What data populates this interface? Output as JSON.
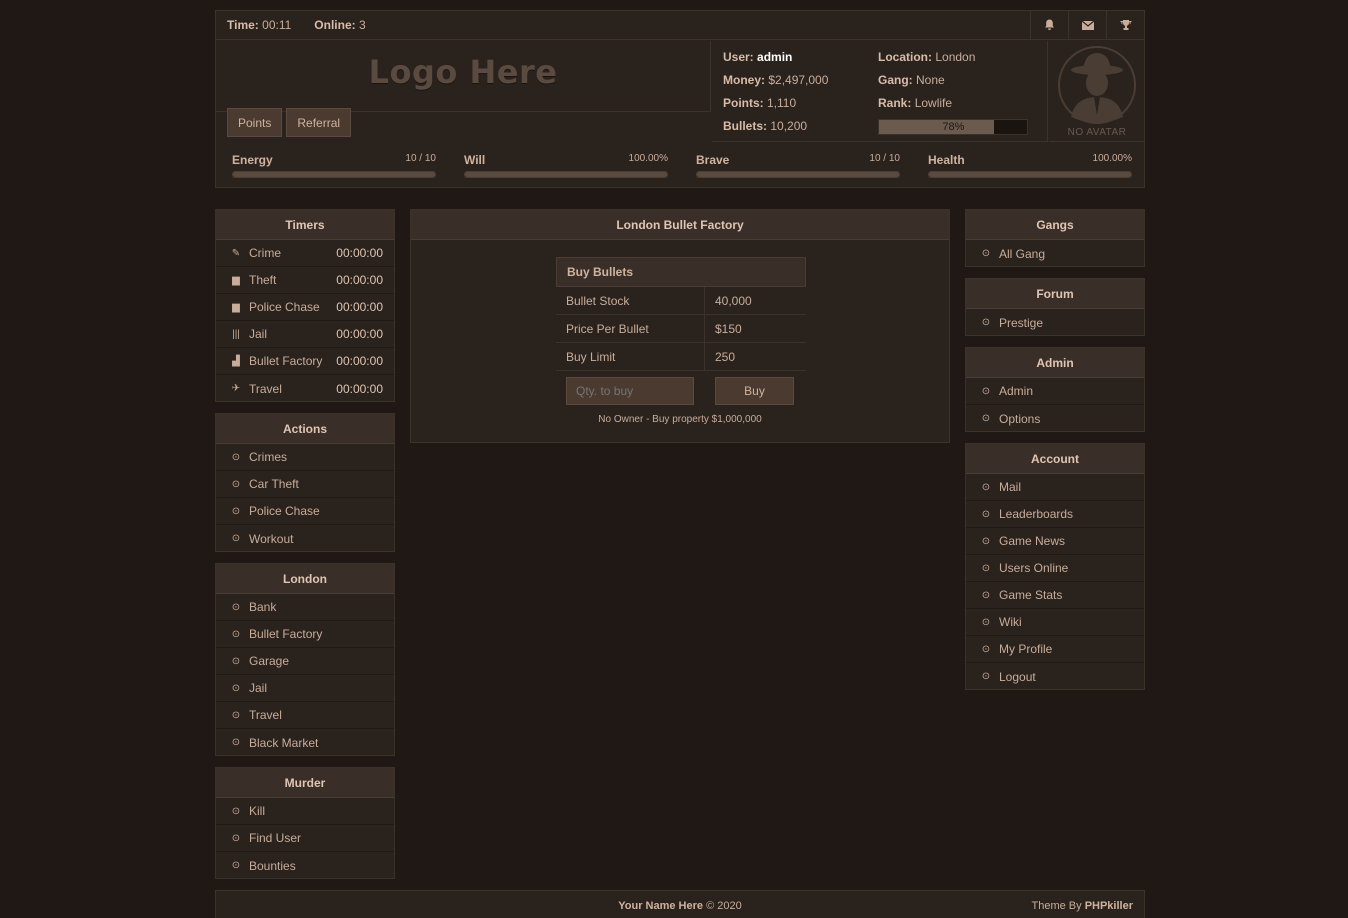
{
  "topbar": {
    "time_label": "Time:",
    "time_value": "00:11",
    "online_label": "Online:",
    "online_value": "3"
  },
  "logo": "Logo Here",
  "header_buttons": [
    "Points",
    "Referral"
  ],
  "user": {
    "user_label": "User:",
    "user_value": "admin",
    "money_label": "Money:",
    "money_value": "$2,497,000",
    "points_label": "Points:",
    "points_value": "1,110",
    "bullets_label": "Bullets:",
    "bullets_value": "10,200",
    "location_label": "Location:",
    "location_value": "London",
    "gang_label": "Gang:",
    "gang_value": "None",
    "rank_label": "Rank:",
    "rank_value": "Lowlife",
    "rank_progress": "78%",
    "no_avatar": "NO AVATAR"
  },
  "stats": [
    {
      "label": "Energy",
      "value": "10 / 10"
    },
    {
      "label": "Will",
      "value": "100.00%"
    },
    {
      "label": "Brave",
      "value": "10 / 10"
    },
    {
      "label": "Health",
      "value": "100.00%"
    }
  ],
  "timers": {
    "title": "Timers",
    "items": [
      {
        "label": "Crime",
        "time": "00:00:00",
        "icon": "crime-icon"
      },
      {
        "label": "Theft",
        "time": "00:00:00",
        "icon": "car-icon"
      },
      {
        "label": "Police Chase",
        "time": "00:00:00",
        "icon": "police-car-icon"
      },
      {
        "label": "Jail",
        "time": "00:00:00",
        "icon": "jail-bars-icon"
      },
      {
        "label": "Bullet Factory",
        "time": "00:00:00",
        "icon": "factory-icon"
      },
      {
        "label": "Travel",
        "time": "00:00:00",
        "icon": "plane-icon"
      }
    ]
  },
  "actions": {
    "title": "Actions",
    "items": [
      "Crimes",
      "Car Theft",
      "Police Chase",
      "Workout"
    ]
  },
  "london": {
    "title": "London",
    "items": [
      "Bank",
      "Bullet Factory",
      "Garage",
      "Jail",
      "Travel",
      "Black Market"
    ]
  },
  "murder": {
    "title": "Murder",
    "items": [
      "Kill",
      "Find User",
      "Bounties"
    ]
  },
  "gangs": {
    "title": "Gangs",
    "items": [
      "All Gang"
    ]
  },
  "forum": {
    "title": "Forum",
    "items": [
      "Prestige"
    ]
  },
  "admin": {
    "title": "Admin",
    "items": [
      "Admin",
      "Options"
    ]
  },
  "account": {
    "title": "Account",
    "items": [
      "Mail",
      "Leaderboards",
      "Game News",
      "Users Online",
      "Game Stats",
      "Wiki",
      "My Profile",
      "Logout"
    ]
  },
  "factory": {
    "title": "London Bullet Factory",
    "box_title": "Buy Bullets",
    "rows": [
      {
        "label": "Bullet Stock",
        "value": "40,000"
      },
      {
        "label": "Price Per Bullet",
        "value": "$150"
      },
      {
        "label": "Buy Limit",
        "value": "250"
      }
    ],
    "qty_placeholder": "Qty. to buy",
    "buy_label": "Buy",
    "owner_text": "No Owner - Buy property $1,000,000"
  },
  "footer": {
    "name": "Your Name Here",
    "year": "© 2020",
    "theme_label": "Theme By",
    "theme_author": "PHPkiller"
  }
}
